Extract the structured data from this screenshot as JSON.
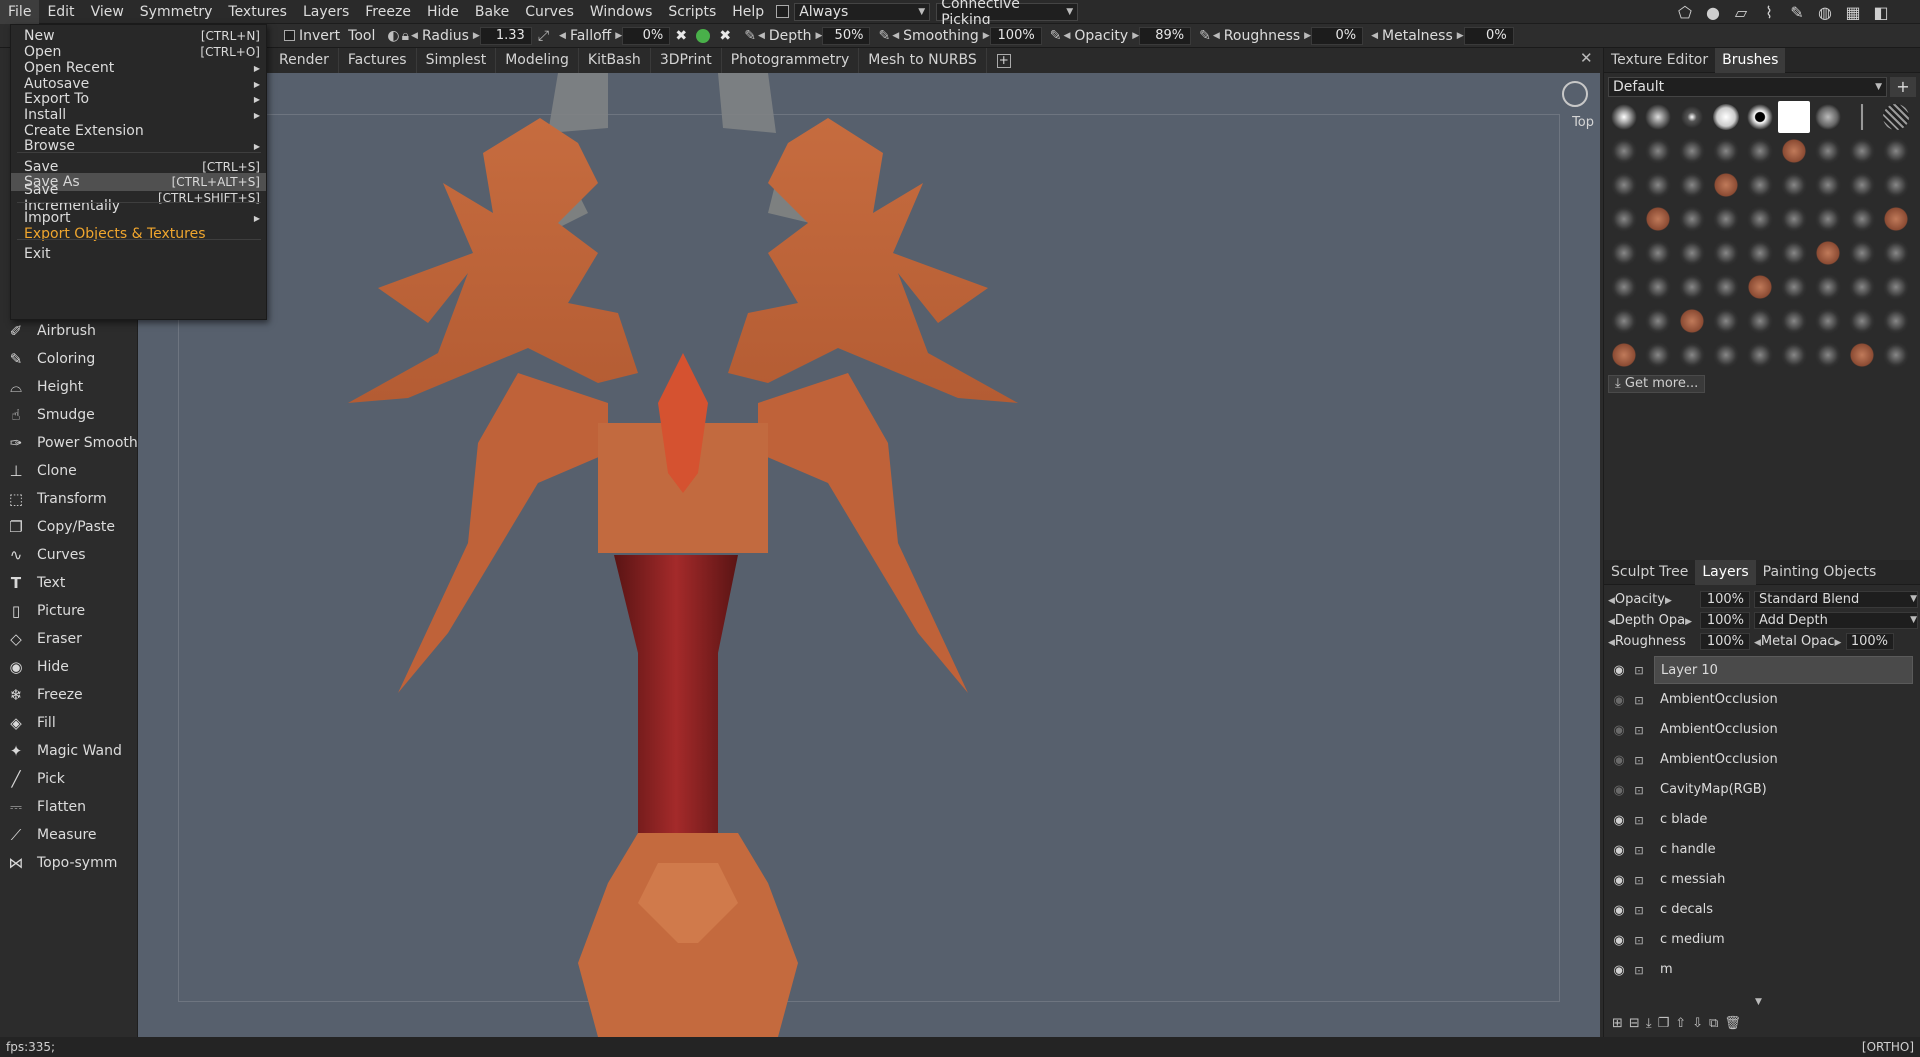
{
  "menubar": {
    "items": [
      "File",
      "Edit",
      "View",
      "Symmetry",
      "Textures",
      "Layers",
      "Freeze",
      "Hide",
      "Bake",
      "Curves",
      "Windows",
      "Scripts",
      "Help"
    ],
    "always_label": "Always",
    "picking_label": "Connective Picking",
    "right_icons": [
      "pentagon-icon",
      "sphere-icon",
      "frame-icon",
      "brush-stroke-icon",
      "tools-icon",
      "sphere-wire-icon",
      "checker-icon",
      "paint-can-icon"
    ]
  },
  "toolbar": {
    "invert_label": "Invert",
    "tool_label": "Tool",
    "radius_label": "Radius",
    "radius_value": "1.33",
    "falloff_label": "Falloff",
    "falloff_value": "0%",
    "depth_label": "Depth",
    "depth_value": "50%",
    "smoothing_label": "Smoothing",
    "smoothing_value": "100%",
    "opacity_label": "Opacity",
    "opacity_value": "89%",
    "roughness_label": "Roughness",
    "roughness_value": "0%",
    "metalness_label": "Metalness",
    "metalness_value": "0%"
  },
  "room_tabs": [
    "Render",
    "Factures",
    "Simplest",
    "Modeling",
    "KitBash",
    "3DPrint",
    "Photogrammetry",
    "Mesh to NURBS"
  ],
  "file_menu": {
    "items": [
      {
        "label": "New",
        "shortcut": "[CTRL+N]"
      },
      {
        "label": "Open",
        "shortcut": "[CTRL+O]"
      },
      {
        "label": "Open Recent",
        "shortcut": ""
      },
      {
        "label": "Autosave",
        "shortcut": ""
      },
      {
        "label": "Export To",
        "shortcut": ""
      },
      {
        "label": "Install",
        "shortcut": ""
      },
      {
        "label": "Create Extension",
        "shortcut": ""
      },
      {
        "label": "Browse",
        "shortcut": ""
      },
      {
        "label": "Save",
        "shortcut": "[CTRL+S]"
      },
      {
        "label": "Save As",
        "shortcut": "[CTRL+ALT+S]"
      },
      {
        "label": "Save Incrementally",
        "shortcut": "[CTRL+SHIFT+S]"
      },
      {
        "label": "Import",
        "shortcut": ""
      },
      {
        "label": "Export Objects & Textures",
        "shortcut": ""
      },
      {
        "label": "Exit",
        "shortcut": ""
      }
    ]
  },
  "left_tools": [
    "Airbrush",
    "Coloring",
    "Height",
    "Smudge",
    "Power Smooth",
    "Clone",
    "Transform",
    "Copy/Paste",
    "Curves",
    "Text",
    "Picture",
    "Eraser",
    "Hide",
    "Freeze",
    "Fill",
    "Magic Wand",
    "Pick",
    "Flatten",
    "Measure",
    "Topo-symm"
  ],
  "viewport": {
    "view_label": "Top",
    "background": "#57606d"
  },
  "brushes_panel": {
    "tabs": [
      "Texture Editor",
      "Brushes"
    ],
    "preset": "Default",
    "get_more": "Get more..."
  },
  "layers_panel": {
    "tabs": [
      "Sculpt Tree",
      "Layers",
      "Painting Objects"
    ],
    "opacity_label": "Opacity",
    "opacity_value": "100%",
    "blend_mode": "Standard Blend",
    "depth_opacity_label": "Depth Opa",
    "depth_opacity_value": "100%",
    "depth_mode": "Add Depth",
    "roughness_label": "Roughness",
    "roughness_value": "100%",
    "metal_label": "Metal Opac",
    "metal_value": "100%",
    "layers": [
      {
        "name": "Layer 10",
        "visible": true,
        "selected": true
      },
      {
        "name": "AmbientOcclusion",
        "visible": false,
        "selected": false
      },
      {
        "name": "AmbientOcclusion",
        "visible": false,
        "selected": false
      },
      {
        "name": "AmbientOcclusion",
        "visible": false,
        "selected": false
      },
      {
        "name": "CavityMap(RGB)",
        "visible": false,
        "selected": false
      },
      {
        "name": "c  blade",
        "visible": true,
        "selected": false
      },
      {
        "name": "c  handle",
        "visible": true,
        "selected": false
      },
      {
        "name": "c  messiah",
        "visible": true,
        "selected": false
      },
      {
        "name": "c  decals",
        "visible": true,
        "selected": false
      },
      {
        "name": "c  medium",
        "visible": true,
        "selected": false
      },
      {
        "name": "m",
        "visible": true,
        "selected": false
      }
    ]
  },
  "status": {
    "fps": "fps:335;",
    "mode": "[ORTHO]"
  },
  "colors": {
    "accent_orange": "#f0a62e",
    "model_orange": "#c8693b",
    "model_red": "#8c2222"
  }
}
